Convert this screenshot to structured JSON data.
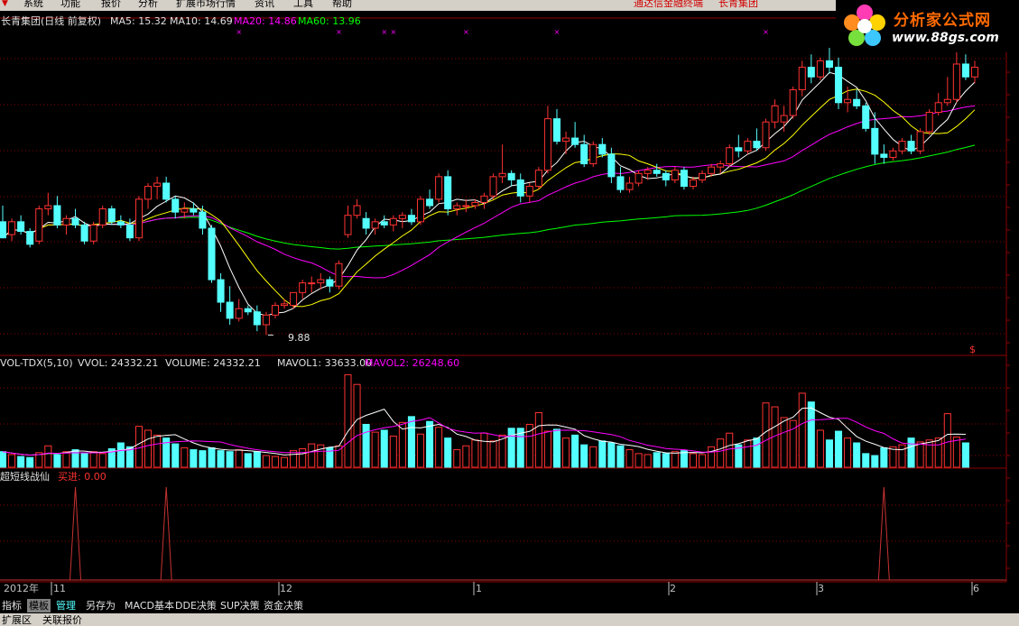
{
  "menu": [
    "系统",
    "功能",
    "报价",
    "分析",
    "扩展市场行情",
    "资讯",
    "工具",
    "帮助"
  ],
  "title_bar": {
    "terminal": "通达信金融终端",
    "stock": "长青集团"
  },
  "logo": {
    "name": "分析家公式网",
    "url": "www.88gs.com"
  },
  "price_panel": {
    "stock_label": "长青集团(日线 前复权)",
    "ma5": "MA5: 15.32",
    "ma10": "MA10: 14.69",
    "ma20": "MA20: 14.86",
    "ma60": "MA60: 13.96",
    "low_marker": "9.88",
    "corner_mark": "$"
  },
  "volume_panel": {
    "name": "VOL-TDX(5,10)",
    "vvol": "VVOL: 24332.21",
    "volume": "VOLUME: 24332.21",
    "mavol1": "MAVOL1: 33633.00",
    "mavol2": "MAVOL2: 26248.60"
  },
  "signal_panel": {
    "name": "超短线战仙",
    "buy": "买进: 0.00"
  },
  "x_axis": {
    "year": "2012年",
    "months": [
      "11",
      "12",
      "1",
      "2",
      "3",
      "6"
    ]
  },
  "tabs": [
    "指标",
    "模板",
    "管理",
    "另存为",
    "MACD基本",
    "DDE决策",
    "SUP决策",
    "资金决策"
  ],
  "bottom": [
    "扩展区",
    "关联报价"
  ],
  "colors": {
    "up": "#ff3232",
    "down": "#54ffff",
    "ma5": "#ffffff",
    "ma10": "#ffff00",
    "ma20": "#ff00ff",
    "ma60": "#00ff00",
    "grid": "#8b0000"
  },
  "chart_data": {
    "type": "candlestick",
    "low_price": 9.88,
    "candles": [
      {
        "o": 13.4,
        "h": 13.9,
        "l": 12.9,
        "c": 12.9
      },
      {
        "o": 13.0,
        "h": 13.5,
        "l": 12.8,
        "c": 13.4
      },
      {
        "o": 13.4,
        "h": 13.6,
        "l": 13.0,
        "c": 13.1
      },
      {
        "o": 13.1,
        "h": 13.2,
        "l": 12.6,
        "c": 12.7
      },
      {
        "o": 12.8,
        "h": 13.9,
        "l": 12.7,
        "c": 13.8
      },
      {
        "o": 13.8,
        "h": 14.3,
        "l": 13.6,
        "c": 13.9
      },
      {
        "o": 13.9,
        "h": 14.2,
        "l": 13.2,
        "c": 13.3
      },
      {
        "o": 13.3,
        "h": 13.6,
        "l": 13.0,
        "c": 13.5
      },
      {
        "o": 13.5,
        "h": 13.8,
        "l": 13.2,
        "c": 13.3
      },
      {
        "o": 13.3,
        "h": 13.4,
        "l": 12.7,
        "c": 12.8
      },
      {
        "o": 12.8,
        "h": 13.4,
        "l": 12.7,
        "c": 13.3
      },
      {
        "o": 13.3,
        "h": 13.9,
        "l": 13.2,
        "c": 13.8
      },
      {
        "o": 13.8,
        "h": 13.9,
        "l": 13.3,
        "c": 13.4
      },
      {
        "o": 13.4,
        "h": 13.6,
        "l": 13.2,
        "c": 13.3
      },
      {
        "o": 13.3,
        "h": 13.5,
        "l": 12.8,
        "c": 12.9
      },
      {
        "o": 12.9,
        "h": 14.2,
        "l": 12.8,
        "c": 14.1
      },
      {
        "o": 14.1,
        "h": 14.6,
        "l": 13.8,
        "c": 14.5
      },
      {
        "o": 14.5,
        "h": 14.8,
        "l": 14.1,
        "c": 14.6
      },
      {
        "o": 14.6,
        "h": 14.8,
        "l": 14.0,
        "c": 14.1
      },
      {
        "o": 14.1,
        "h": 14.2,
        "l": 13.5,
        "c": 13.7
      },
      {
        "o": 13.7,
        "h": 14.0,
        "l": 13.5,
        "c": 13.8
      },
      {
        "o": 13.8,
        "h": 14.0,
        "l": 13.6,
        "c": 13.7
      },
      {
        "o": 13.7,
        "h": 13.9,
        "l": 13.0,
        "c": 13.2
      },
      {
        "o": 13.2,
        "h": 13.3,
        "l": 11.5,
        "c": 11.6
      },
      {
        "o": 11.6,
        "h": 11.8,
        "l": 10.6,
        "c": 10.9
      },
      {
        "o": 10.9,
        "h": 11.4,
        "l": 10.2,
        "c": 10.4
      },
      {
        "o": 10.4,
        "h": 11.0,
        "l": 10.3,
        "c": 10.7
      },
      {
        "o": 10.7,
        "h": 10.8,
        "l": 10.5,
        "c": 10.6
      },
      {
        "o": 10.6,
        "h": 10.8,
        "l": 10.0,
        "c": 10.2
      },
      {
        "o": 10.2,
        "h": 10.6,
        "l": 9.88,
        "c": 10.5
      },
      {
        "o": 10.5,
        "h": 10.9,
        "l": 10.4,
        "c": 10.8
      },
      {
        "o": 10.8,
        "h": 11.0,
        "l": 10.7,
        "c": 10.85
      },
      {
        "o": 10.8,
        "h": 11.2,
        "l": 10.7,
        "c": 11.2
      },
      {
        "o": 11.2,
        "h": 11.6,
        "l": 11.0,
        "c": 11.5
      },
      {
        "o": 11.5,
        "h": 11.7,
        "l": 11.2,
        "c": 11.5
      },
      {
        "o": 11.5,
        "h": 11.8,
        "l": 11.3,
        "c": 11.6
      },
      {
        "o": 11.6,
        "h": 11.7,
        "l": 11.2,
        "c": 11.4
      },
      {
        "o": 11.4,
        "h": 12.2,
        "l": 11.3,
        "c": 12.1
      },
      {
        "o": 13.0,
        "h": 13.9,
        "l": 12.9,
        "c": 13.6
      },
      {
        "o": 13.6,
        "h": 14.1,
        "l": 13.5,
        "c": 13.9
      },
      {
        "o": 13.5,
        "h": 13.7,
        "l": 13.0,
        "c": 13.2
      },
      {
        "o": 13.2,
        "h": 13.5,
        "l": 13.0,
        "c": 13.4
      },
      {
        "o": 13.4,
        "h": 13.6,
        "l": 13.2,
        "c": 13.3
      },
      {
        "o": 13.3,
        "h": 13.6,
        "l": 13.1,
        "c": 13.5
      },
      {
        "o": 13.5,
        "h": 13.7,
        "l": 13.2,
        "c": 13.6
      },
      {
        "o": 13.6,
        "h": 13.8,
        "l": 13.3,
        "c": 13.4
      },
      {
        "o": 13.4,
        "h": 14.2,
        "l": 13.3,
        "c": 14.1
      },
      {
        "o": 14.1,
        "h": 14.4,
        "l": 13.8,
        "c": 13.9
      },
      {
        "o": 14.1,
        "h": 14.9,
        "l": 14.0,
        "c": 14.8
      },
      {
        "o": 14.8,
        "h": 15.0,
        "l": 13.6,
        "c": 13.8
      },
      {
        "o": 13.8,
        "h": 14.0,
        "l": 13.6,
        "c": 13.9
      },
      {
        "o": 13.9,
        "h": 14.1,
        "l": 13.7,
        "c": 13.9
      },
      {
        "o": 13.9,
        "h": 14.1,
        "l": 13.8,
        "c": 14.0
      },
      {
        "o": 14.0,
        "h": 14.3,
        "l": 13.8,
        "c": 14.2
      },
      {
        "o": 14.2,
        "h": 14.9,
        "l": 14.1,
        "c": 14.8
      },
      {
        "o": 14.8,
        "h": 15.8,
        "l": 14.6,
        "c": 14.9
      },
      {
        "o": 14.9,
        "h": 15.0,
        "l": 14.5,
        "c": 14.7
      },
      {
        "o": 14.7,
        "h": 14.9,
        "l": 14.0,
        "c": 14.2
      },
      {
        "o": 14.2,
        "h": 14.6,
        "l": 14.0,
        "c": 14.5
      },
      {
        "o": 14.5,
        "h": 15.1,
        "l": 14.4,
        "c": 15.0
      },
      {
        "o": 15.0,
        "h": 17.0,
        "l": 14.9,
        "c": 16.6
      },
      {
        "o": 16.6,
        "h": 16.9,
        "l": 15.8,
        "c": 15.9
      },
      {
        "o": 15.9,
        "h": 16.2,
        "l": 15.5,
        "c": 16.0
      },
      {
        "o": 16.0,
        "h": 16.5,
        "l": 15.7,
        "c": 15.8
      },
      {
        "o": 15.8,
        "h": 16.1,
        "l": 15.1,
        "c": 15.2
      },
      {
        "o": 15.2,
        "h": 15.9,
        "l": 15.1,
        "c": 15.8
      },
      {
        "o": 15.8,
        "h": 16.0,
        "l": 15.4,
        "c": 15.5
      },
      {
        "o": 15.5,
        "h": 15.7,
        "l": 14.6,
        "c": 14.8
      },
      {
        "o": 14.8,
        "h": 15.1,
        "l": 14.3,
        "c": 14.4
      },
      {
        "o": 14.4,
        "h": 14.8,
        "l": 14.3,
        "c": 14.6
      },
      {
        "o": 14.6,
        "h": 15.0,
        "l": 14.5,
        "c": 14.9
      },
      {
        "o": 14.9,
        "h": 15.1,
        "l": 14.7,
        "c": 15.0
      },
      {
        "o": 15.0,
        "h": 15.2,
        "l": 14.8,
        "c": 14.9
      },
      {
        "o": 14.9,
        "h": 15.0,
        "l": 14.5,
        "c": 14.7
      },
      {
        "o": 14.7,
        "h": 15.1,
        "l": 14.6,
        "c": 15.0
      },
      {
        "o": 15.0,
        "h": 15.1,
        "l": 14.4,
        "c": 14.5
      },
      {
        "o": 14.5,
        "h": 14.8,
        "l": 14.4,
        "c": 14.7
      },
      {
        "o": 14.7,
        "h": 15.0,
        "l": 14.6,
        "c": 14.9
      },
      {
        "o": 14.9,
        "h": 15.2,
        "l": 14.8,
        "c": 15.1
      },
      {
        "o": 15.1,
        "h": 15.3,
        "l": 14.9,
        "c": 15.2
      },
      {
        "o": 15.2,
        "h": 15.8,
        "l": 15.1,
        "c": 15.7
      },
      {
        "o": 15.7,
        "h": 16.1,
        "l": 15.4,
        "c": 15.6
      },
      {
        "o": 15.6,
        "h": 16.0,
        "l": 15.5,
        "c": 15.9
      },
      {
        "o": 15.9,
        "h": 16.3,
        "l": 15.6,
        "c": 15.7
      },
      {
        "o": 15.7,
        "h": 16.6,
        "l": 15.6,
        "c": 16.5
      },
      {
        "o": 16.5,
        "h": 17.2,
        "l": 16.3,
        "c": 17.0
      },
      {
        "o": 16.5,
        "h": 17.0,
        "l": 16.2,
        "c": 16.7
      },
      {
        "o": 16.7,
        "h": 17.6,
        "l": 16.6,
        "c": 17.5
      },
      {
        "o": 17.5,
        "h": 18.4,
        "l": 17.3,
        "c": 18.2
      },
      {
        "o": 18.2,
        "h": 18.6,
        "l": 17.7,
        "c": 17.9
      },
      {
        "o": 17.9,
        "h": 18.5,
        "l": 17.8,
        "c": 18.4
      },
      {
        "o": 18.4,
        "h": 18.8,
        "l": 18.0,
        "c": 18.2
      },
      {
        "o": 18.2,
        "h": 18.5,
        "l": 16.9,
        "c": 17.1
      },
      {
        "o": 17.1,
        "h": 17.6,
        "l": 16.8,
        "c": 17.2
      },
      {
        "o": 17.2,
        "h": 17.5,
        "l": 16.9,
        "c": 17.0
      },
      {
        "o": 17.0,
        "h": 17.1,
        "l": 16.2,
        "c": 16.3
      },
      {
        "o": 16.3,
        "h": 16.8,
        "l": 15.2,
        "c": 15.5
      },
      {
        "o": 15.5,
        "h": 15.8,
        "l": 15.2,
        "c": 15.4
      },
      {
        "o": 15.4,
        "h": 15.7,
        "l": 15.3,
        "c": 15.6
      },
      {
        "o": 15.6,
        "h": 16.0,
        "l": 15.5,
        "c": 15.9
      },
      {
        "o": 15.9,
        "h": 16.1,
        "l": 15.5,
        "c": 15.6
      },
      {
        "o": 15.6,
        "h": 16.3,
        "l": 15.5,
        "c": 16.2
      },
      {
        "o": 16.2,
        "h": 16.9,
        "l": 16.1,
        "c": 16.8
      },
      {
        "o": 16.8,
        "h": 17.4,
        "l": 16.7,
        "c": 17.1
      },
      {
        "o": 17.1,
        "h": 17.9,
        "l": 17.0,
        "c": 17.2
      },
      {
        "o": 17.2,
        "h": 18.9,
        "l": 17.1,
        "c": 18.3
      },
      {
        "o": 18.3,
        "h": 18.6,
        "l": 17.8,
        "c": 17.9
      },
      {
        "o": 17.9,
        "h": 18.4,
        "l": 17.7,
        "c": 18.2
      }
    ],
    "volume": [
      16000,
      13000,
      11000,
      10000,
      15000,
      22000,
      13000,
      16000,
      18000,
      14000,
      16000,
      14000,
      19000,
      25000,
      21000,
      42000,
      38000,
      33000,
      30000,
      24000,
      20000,
      18000,
      17000,
      20000,
      17000,
      16000,
      18000,
      14000,
      16000,
      12000,
      11000,
      10000,
      17000,
      19000,
      24000,
      23000,
      20000,
      22000,
      95000,
      85000,
      44000,
      36000,
      38000,
      32000,
      46000,
      52000,
      34000,
      47000,
      41000,
      30000,
      18000,
      22000,
      28000,
      35000,
      27000,
      33000,
      40000,
      40000,
      44000,
      56000,
      37000,
      39000,
      30000,
      33000,
      23000,
      21000,
      27000,
      25000,
      22000,
      18000,
      14000,
      13000,
      15000,
      14000,
      16000,
      17000,
      14000,
      13000,
      21000,
      29000,
      35000,
      23000,
      28000,
      30000,
      66000,
      62000,
      51000,
      48000,
      76000,
      67000,
      38000,
      28000,
      37000,
      30000,
      25000,
      14000,
      12000,
      20000,
      21000,
      23000,
      30000,
      26000,
      28000,
      30000,
      55000,
      31000,
      25000
    ],
    "signal_peaks": [
      8,
      18,
      97
    ]
  }
}
